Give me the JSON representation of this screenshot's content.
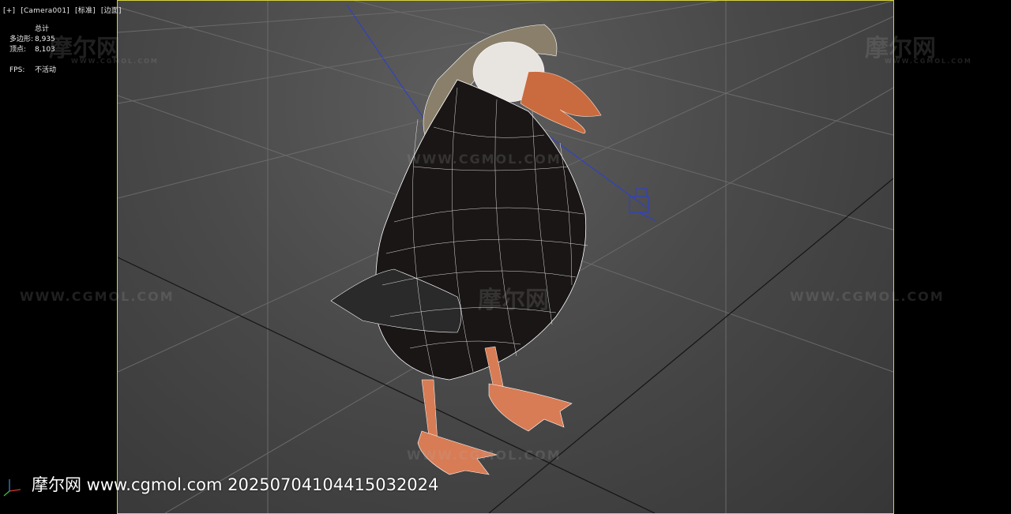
{
  "viewport_label": {
    "plus": "[+]",
    "camera": "[Camera001]",
    "shading": "[标准]",
    "edges": "[边面]"
  },
  "stats": {
    "header": "总计",
    "polygons_label": "多边形:",
    "polygons_value": "8,935",
    "vertices_label": "顶点:",
    "vertices_value": "8,103",
    "fps_label": "FPS:",
    "fps_value": "不活动"
  },
  "watermark": {
    "logo": "摩尔网",
    "url": "WWW.CGMOL.COM",
    "url_small": "WWW.CGMOL.COM"
  },
  "caption": "摩尔网 www.cgmol.com 20250704104415032024",
  "colors": {
    "frame_border": "#d6d23a",
    "wire": "#ffffff",
    "body": "#1a1616",
    "beak": "#c96b3f",
    "feet": "#d87c55",
    "light_gizmo": "#2a3fd6"
  }
}
